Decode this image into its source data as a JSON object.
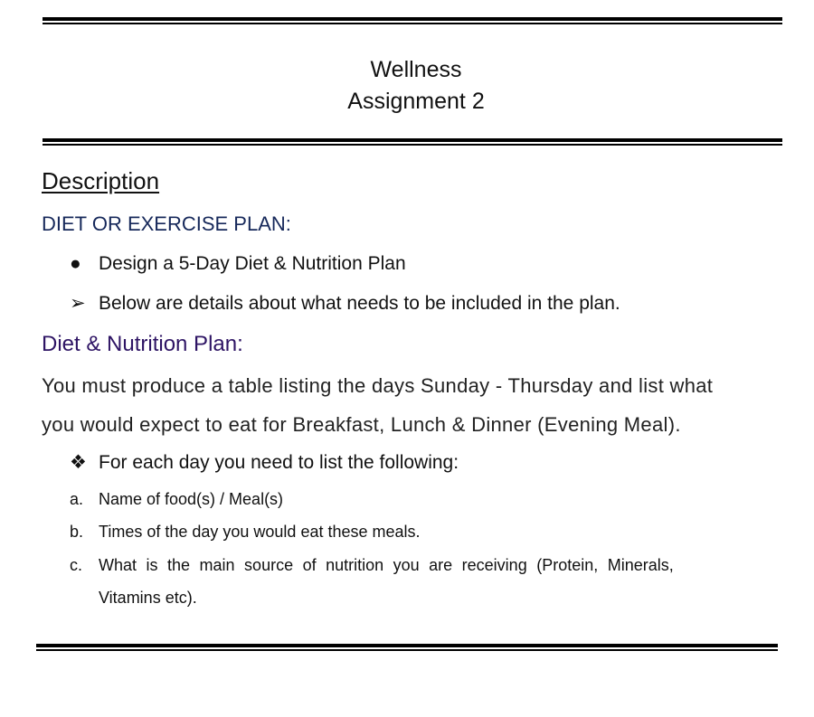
{
  "header": {
    "line1": "Wellness",
    "line2": "Assignment 2"
  },
  "description": {
    "heading": "Description",
    "subheading": "DIET OR EXERCISE PLAN:",
    "bullets": [
      {
        "marker": "●",
        "text": "Design a 5-Day Diet & Nutrition Plan"
      },
      {
        "marker": "➢",
        "text": "Below are details about what needs to be included in the plan."
      }
    ]
  },
  "plan": {
    "heading": "Diet & Nutrition Plan:",
    "paragraph_line1": "You must produce a table listing the days Sunday - Thursday and list what",
    "paragraph_line2": "you would expect to eat for Breakfast, Lunch & Dinner (Evening Meal).",
    "requirement": {
      "marker": "❖",
      "text": "For each day you need to list the following:"
    },
    "items": [
      {
        "label": "a.",
        "text": "Name of food(s) / Meal(s)"
      },
      {
        "label": "b.",
        "text": "Times of the day you would eat these meals."
      },
      {
        "label": "c.",
        "text": "What is the main source of nutrition you are receiving (Protein, Minerals,",
        "continuation": "Vitamins etc)."
      }
    ]
  },
  "colors": {
    "subheading": "#16285a",
    "plan_heading": "#2e1464"
  }
}
